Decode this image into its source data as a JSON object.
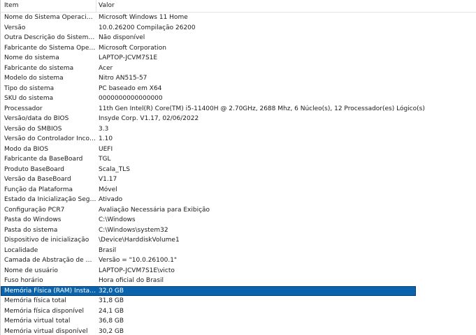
{
  "columns": {
    "item": "Item",
    "value": "Valor"
  },
  "rows": [
    {
      "item": "Nome do Sistema Operacional",
      "value": "Microsoft Windows 11 Home"
    },
    {
      "item": "Versão",
      "value": "10.0.26200 Compilação 26200"
    },
    {
      "item": "Outra Descrição do Sistema O...",
      "value": "Não disponível"
    },
    {
      "item": "Fabricante do Sistema Operaci...",
      "value": "Microsoft Corporation"
    },
    {
      "item": "Nome do sistema",
      "value": "LAPTOP-JCVM7S1E"
    },
    {
      "item": "Fabricante do sistema",
      "value": "Acer"
    },
    {
      "item": "Modelo do sistema",
      "value": "Nitro AN515-57"
    },
    {
      "item": "Tipo do sistema",
      "value": "PC baseado em X64"
    },
    {
      "item": "SKU do sistema",
      "value": "0000000000000000"
    },
    {
      "item": "Processador",
      "value": "11th Gen Intel(R) Core(TM) i5-11400H @ 2.70GHz, 2688 Mhz, 6 Núcleo(s), 12 Processador(es) Lógico(s)"
    },
    {
      "item": "Versão/data do BIOS",
      "value": "Insyde Corp. V1.17, 02/06/2022"
    },
    {
      "item": "Versão do SMBIOS",
      "value": "3.3"
    },
    {
      "item": "Versão do Controlador Incorp...",
      "value": "1.10"
    },
    {
      "item": "Modo da BIOS",
      "value": "UEFI"
    },
    {
      "item": "Fabricante da BaseBoard",
      "value": "TGL"
    },
    {
      "item": "Produto BaseBoard",
      "value": "Scala_TLS"
    },
    {
      "item": "Versão da BaseBoard",
      "value": "V1.17"
    },
    {
      "item": "Função da Plataforma",
      "value": "Móvel"
    },
    {
      "item": "Estado da Inicialização Segura",
      "value": "Ativado"
    },
    {
      "item": "Configuração PCR7",
      "value": "Avaliação Necessária para Exibição"
    },
    {
      "item": "Pasta do Windows",
      "value": "C:\\Windows"
    },
    {
      "item": "Pasta do sistema",
      "value": "C:\\Windows\\system32"
    },
    {
      "item": "Dispositivo de inicialização",
      "value": "\\Device\\HarddiskVolume1"
    },
    {
      "item": "Localidade",
      "value": "Brasil"
    },
    {
      "item": "Camada de Abstração de Har...",
      "value": "Versão = \"10.0.26100.1\""
    },
    {
      "item": "Nome de usuário",
      "value": "LAPTOP-JCVM7S1E\\victo"
    },
    {
      "item": "Fuso horário",
      "value": "Hora oficial do Brasil"
    },
    {
      "item": "Memória Física (RAM) Instalada",
      "value": "32,0 GB"
    },
    {
      "item": "Memória física total",
      "value": "31,8 GB"
    },
    {
      "item": "Memória física disponível",
      "value": "24,1 GB"
    },
    {
      "item": "Memória virtual total",
      "value": "36,8 GB"
    },
    {
      "item": "Memória virtual disponível",
      "value": "30,2 GB"
    }
  ],
  "selected_item": "Memória Física (RAM) Instalada",
  "colors": {
    "selection": "#0a64ad",
    "selection_border": "#0a3d6e"
  }
}
